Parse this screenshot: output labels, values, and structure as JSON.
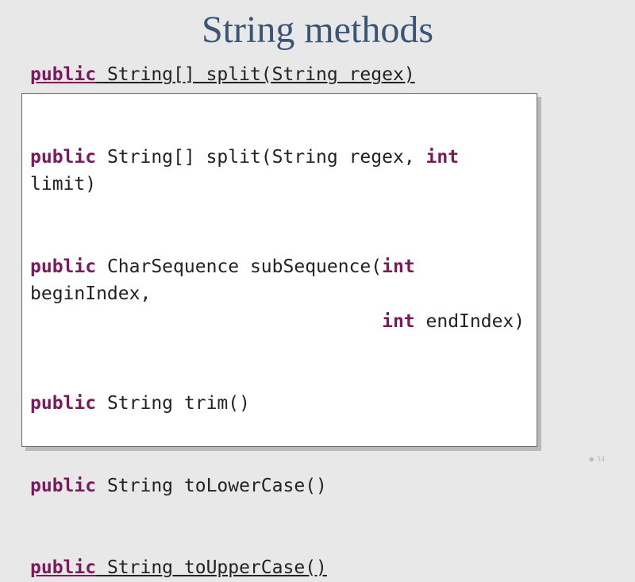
{
  "title": "String methods",
  "signatures": {
    "m1_kw": "public",
    "m1_rest": " String[] split(String regex)",
    "m2_kw": "public",
    "m2_rest_a": " String[] split(String regex, ",
    "m2_kw2": "int",
    "m2_rest_b": "limit)",
    "m3_kw": "public",
    "m3_rest_a": " CharSequence subSequence(",
    "m3_kw2": "int",
    "m3_rest_b": "beginIndex,",
    "m3_pad": "                                ",
    "m3_kw3": "int",
    "m3_rest_c": " endIndex)",
    "m4_kw": "public",
    "m4_rest": " String trim()",
    "m5_kw": "public",
    "m5_rest": " String toLowerCase()",
    "m6_kw": "public",
    "m6_rest": " String toUpperCase()"
  },
  "page_number": "34"
}
